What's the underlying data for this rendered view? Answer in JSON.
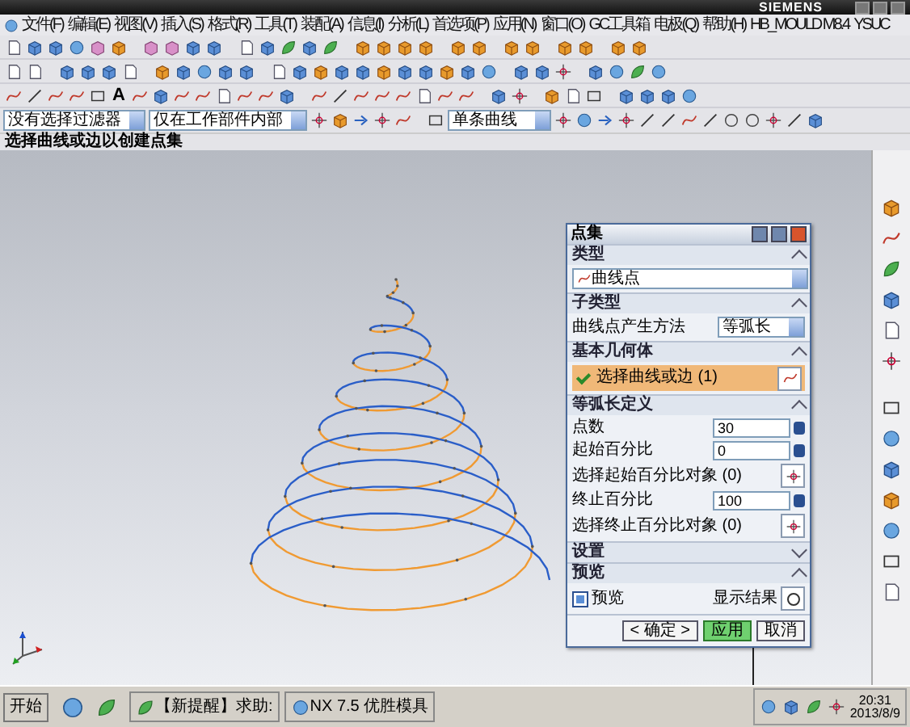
{
  "title_bar": {
    "brand": "SIEMENS"
  },
  "menu": [
    "文件(F)",
    "编辑(E)",
    "视图(V)",
    "插入(S)",
    "格式(R)",
    "工具(T)",
    "装配(A)",
    "信息(I)",
    "分析(L)",
    "首选项(P)",
    "应用(N)",
    "窗口(O)",
    "GC工具箱",
    "电极(Q)",
    "帮助(H)",
    "HB_MOULD M8.4",
    "YSUC"
  ],
  "toolbar": {
    "text_tool": "A"
  },
  "selection_bar": {
    "filter": "没有选择过滤器",
    "scope": "仅在工作部件内部",
    "curve_rule": "单条曲线"
  },
  "status_text": "选择曲线或边以创建点集",
  "dialog": {
    "title": "点集",
    "sections": [
      {
        "title": "类型",
        "expanded": true,
        "rows": [
          {
            "kind": "dropdown",
            "value": "曲线点"
          }
        ]
      },
      {
        "title": "子类型",
        "expanded": true,
        "rows": [
          {
            "kind": "labeled_dropdown",
            "label": "曲线点产生方法",
            "value": "等弧长"
          }
        ]
      },
      {
        "title": "基本几何体",
        "expanded": true,
        "rows": [
          {
            "kind": "selection",
            "label": "选择曲线或边 (1)",
            "selected": true
          }
        ]
      },
      {
        "title": "等弧长定义",
        "expanded": true,
        "rows": [
          {
            "kind": "number",
            "label": "点数",
            "value": "30"
          },
          {
            "kind": "number",
            "label": "起始百分比",
            "value": "0"
          },
          {
            "kind": "pick",
            "label": "选择起始百分比对象 (0)"
          },
          {
            "kind": "number",
            "label": "终止百分比",
            "value": "100"
          },
          {
            "kind": "pick",
            "label": "选择终止百分比对象 (0)"
          }
        ]
      },
      {
        "title": "设置",
        "expanded": false
      },
      {
        "title": "预览",
        "expanded": true,
        "rows": [
          {
            "kind": "preview",
            "label": "预览",
            "checked": true,
            "button": "显示结果"
          }
        ]
      }
    ],
    "buttons": [
      {
        "label": "< 确定 >",
        "highlighted": false
      },
      {
        "label": "应用",
        "highlighted": true
      },
      {
        "label": "取消",
        "highlighted": false
      }
    ]
  },
  "taskbar": {
    "start": "开始",
    "tasks": [
      "【新提醒】求助:",
      "NX 7.5 优胜模具"
    ],
    "clock": {
      "time": "20:31",
      "date": "2013/8/9"
    }
  }
}
